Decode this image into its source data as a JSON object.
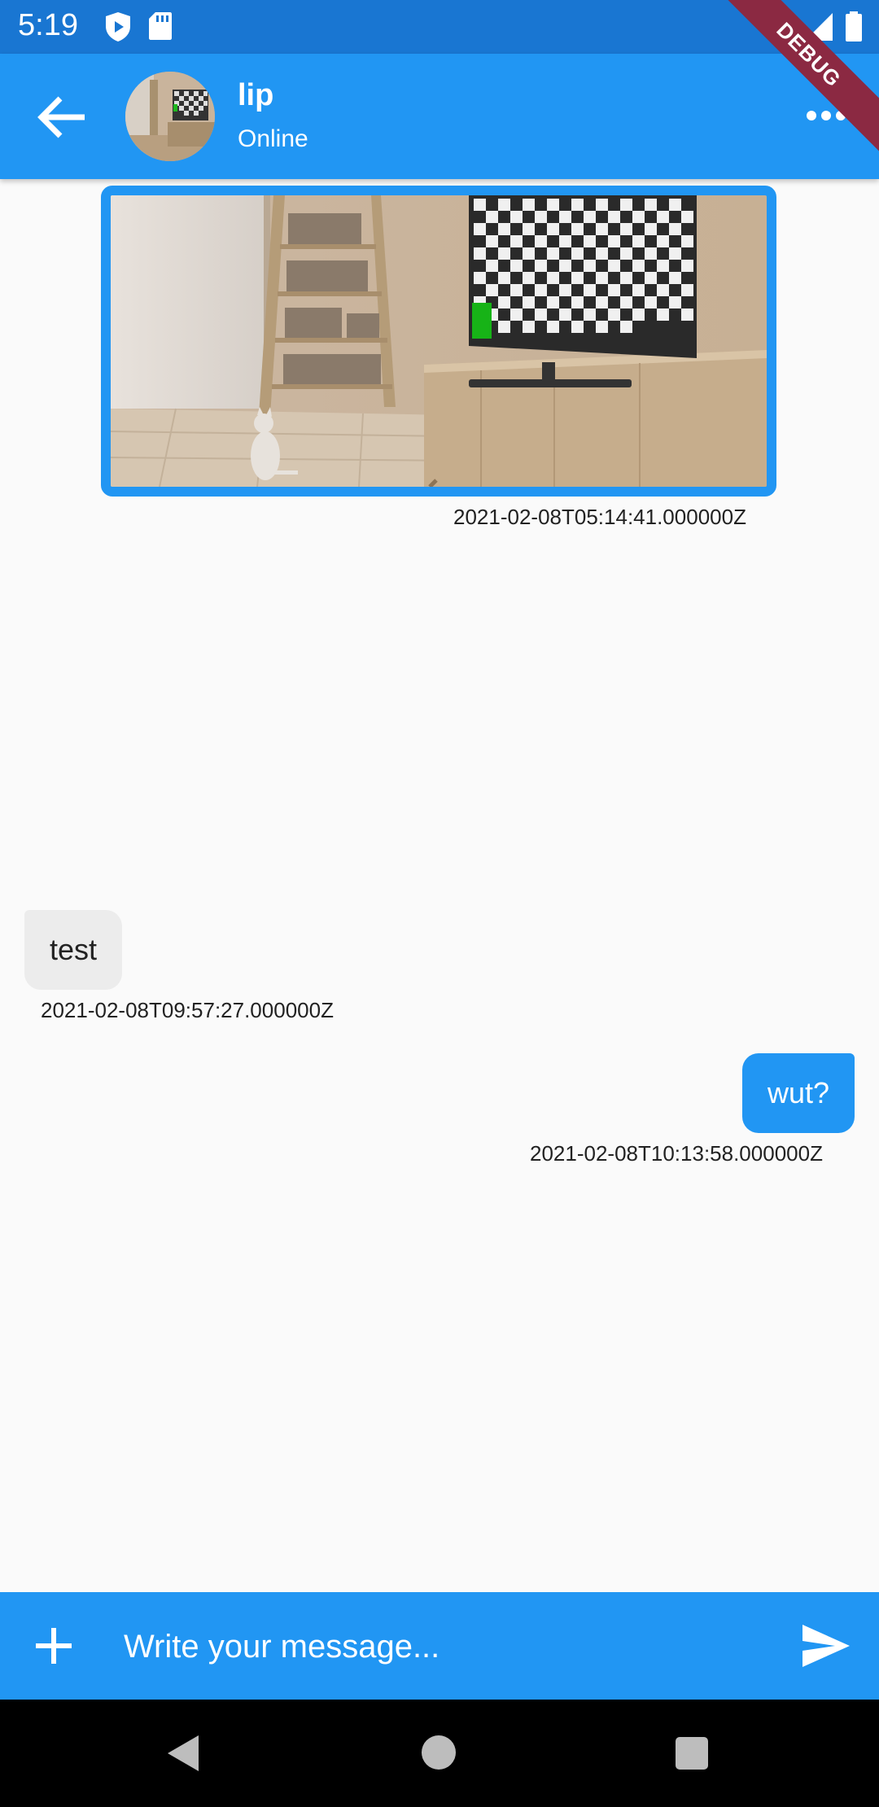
{
  "status_bar": {
    "time": "5:19",
    "icons": [
      "shield-play-icon",
      "sd-card-icon",
      "wifi-icon",
      "signal-icon",
      "battery-icon"
    ]
  },
  "debug_banner": "DEBUG",
  "header": {
    "back_icon": "arrow-left-icon",
    "contact_name": "lip",
    "contact_status": "Online",
    "more_icon": "more-horizontal-icon"
  },
  "messages": [
    {
      "type": "image",
      "direction": "outgoing",
      "timestamp": "2021-02-08T05:14:41.000000Z"
    },
    {
      "type": "text",
      "direction": "incoming",
      "text": "test",
      "timestamp": "2021-02-08T09:57:27.000000Z"
    },
    {
      "type": "text",
      "direction": "outgoing",
      "text": "wut?",
      "timestamp": "2021-02-08T10:13:58.000000Z"
    }
  ],
  "composer": {
    "add_icon": "plus-icon",
    "placeholder": "Write your message...",
    "send_icon": "send-icon"
  },
  "nav_bar": {
    "icons": [
      "back-triangle-icon",
      "home-circle-icon",
      "recents-square-icon"
    ]
  },
  "colors": {
    "primary": "#2196f3",
    "status_bar": "#1976d2",
    "incoming_bubble": "#ececec",
    "debug_ribbon": "#8b2942"
  }
}
